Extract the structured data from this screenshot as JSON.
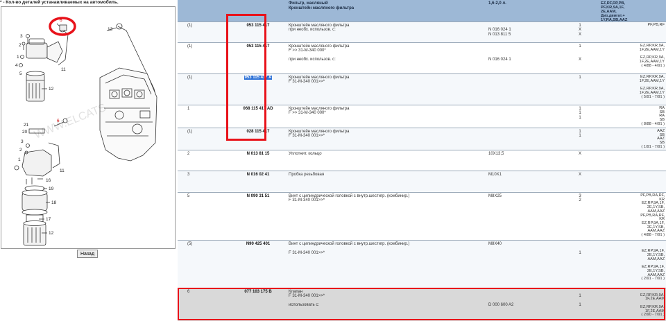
{
  "note": "* - Кол-во деталей устанавливаемых на автомобиль.",
  "watermark": "WWW.ELCATS",
  "back_button": "Назад",
  "diagram_labels": {
    "l6": "6",
    "l13": "13",
    "l3": "3",
    "l2": "2",
    "l11a": "11",
    "l1a": "1",
    "l4": "4",
    "l5": "5",
    "l12a": "12",
    "l21": "21",
    "l20": "20",
    "l3b": "3",
    "l2b": "2",
    "l1b": "1",
    "l11b": "11",
    "l16": "16",
    "l19": "19",
    "l18": "18",
    "l17": "17",
    "l12b": "12",
    "l6b": "6"
  },
  "header": {
    "desc_line1": "Фильтр, масляный",
    "desc_line2": "Кронштейн масляного фильтра",
    "spec": "1,6-2,0 л.",
    "eng": "EZ,RF,RP,PB,\nPF,KR,9A,1F,\n2E,AAM,\nДиз.двигат.+\n1Y,RA,SB,AAZ"
  },
  "rows": [
    {
      "num": "(1)",
      "pn": "053 115 417",
      "desc": [
        "Кронштейн масляного фильтра",
        "при необх. использов. с:"
      ],
      "spec": [
        "",
        "N 016 024 1",
        "N 013 811 5"
      ],
      "qty": [
        "1",
        "X",
        "X"
      ],
      "eng": "PF,PB,RF"
    },
    {
      "num": "(1)",
      "pn": "053 115 417",
      "desc": [
        "Кронштейн масляного фильтра",
        "F >> 31-M-340 000*",
        "",
        "при необх. использов. с:"
      ],
      "spec": [
        "",
        "",
        "",
        "N 016 024 1"
      ],
      "qty": [
        "1",
        "",
        "",
        "X"
      ],
      "eng": "EZ,RP,KR,9A,\n1F,2E,AAM,1Y\n\nEZ,RP,KR,9A,\n1F,2E,AAM,1Y\n( 4/88 - 4/91 )"
    },
    {
      "num": "(1)",
      "pn": "053 115 417 A",
      "desc": [
        "Кронштейн масляного фильтра",
        "F 31-M-340 001>>*"
      ],
      "spec": [],
      "qty": [
        "1"
      ],
      "eng": "EZ,RP,KR,9A,\n1F,2E,AAM,1Y\n\nEZ,RP,KR,9A,\n1F,2E,AAM,1Y\n( 5/91 - 7/91 )"
    },
    {
      "num": "1",
      "pn": "068 115 417 AD",
      "desc": [
        "Кронштейн масляного фильтра",
        "F >> 31-M-340 000*"
      ],
      "spec": [],
      "qty": [
        "1",
        "1",
        "1"
      ],
      "eng": "RA\nSB\nRA\nSB\n( 8/88 - 4/91 )"
    },
    {
      "num": "(1)",
      "pn": "028 115 417",
      "desc": [
        "Кронштейн масляного фильтра",
        "F 31-M-340 001>>*"
      ],
      "spec": [],
      "qty": [
        "1",
        "1"
      ],
      "eng": "AAZ\nSB\nAAZ\nSB\n( 1/91 - 7/91 )"
    },
    {
      "num": "2",
      "pn": "N 013 81 15",
      "desc": [
        "Уплотнит. кольцо"
      ],
      "spec": [
        "10X13,5"
      ],
      "qty": [
        "X"
      ],
      "eng": ""
    },
    {
      "num": "3",
      "pn": "N 016 02 41",
      "desc": [
        "Пробка резьбовая"
      ],
      "spec": [
        "M10X1"
      ],
      "qty": [
        "X"
      ],
      "eng": ""
    },
    {
      "num": "5",
      "pn": "N 090 31 51",
      "desc": [
        "Винт с цилиндрической головкой с внутр.шестигр. (комбинир.)",
        "F 31-M-340 001>>*"
      ],
      "spec": [
        "M8X25"
      ],
      "qty": [
        "3",
        "2"
      ],
      "eng": "PF,PB,RA,RF,\nKR\nEZ,RP,9A,1F,\n2E,1Y,SB,\nAAM,AAZ\nPF,PB,RA,RF,\nKR\nEZ,RP,9A,1F,\n2E,1Y,SB,\nAAM,AAZ\n( 4/88 - 7/91 )"
    },
    {
      "num": "(5)",
      "pn": "N90 425 401",
      "desc": [
        "Винт с цилиндрической головкой с внутр.шестигр. (комбинир.)",
        "",
        "F 31-M-340 001>>*"
      ],
      "spec": [
        "M8X40"
      ],
      "qty": [
        "",
        "",
        "1"
      ],
      "eng": "\n\nEZ,RP,9A,1F,\n2E,1Y,SB,\nAAM,AAZ\n\nEZ,RP,9A,1F,\n2E,1Y,SB,\nAAM,AAZ\n( 2/91 - 7/91 )"
    },
    {
      "num": "6",
      "pn": "077 103 175 B",
      "desc": [
        "Клапан",
        "F 31-M-340 001>>*",
        "",
        "использовать с:"
      ],
      "spec": [
        "",
        "",
        "",
        "D 000 600 A2"
      ],
      "qty": [
        "",
        "1",
        "",
        "1"
      ],
      "eng": "\nEZ,RP,KR,9A,\n1F,2E,AAM\n\nEZ,RP,KR,9A,\n1F,2E,AAM\n( 2/90 - 7/91 )"
    }
  ]
}
